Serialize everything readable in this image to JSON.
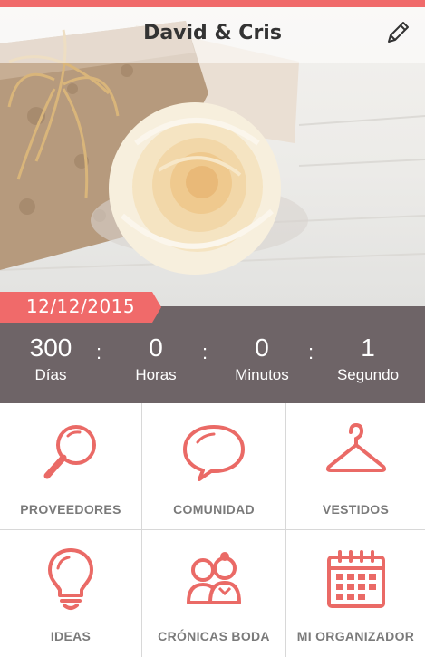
{
  "header": {
    "title": "David & Cris",
    "edit_icon": "pencil-icon"
  },
  "hero": {
    "image": "gift-box-and-white-rose-photo"
  },
  "wedding_date": "12/12/2015",
  "countdown": [
    {
      "value": "300",
      "label": "Días"
    },
    {
      "value": "0",
      "label": "Horas"
    },
    {
      "value": "0",
      "label": "Minutos"
    },
    {
      "value": "1",
      "label": "Segundo"
    }
  ],
  "countdown_separator": ":",
  "menu": [
    {
      "label": "PROVEEDORES",
      "icon": "magnifier-icon"
    },
    {
      "label": "COMUNIDAD",
      "icon": "speech-bubble-icon"
    },
    {
      "label": "VESTIDOS",
      "icon": "hanger-icon"
    },
    {
      "label": "IDEAS",
      "icon": "lightbulb-icon"
    },
    {
      "label": "CRÓNICAS BODA",
      "icon": "couple-icon"
    },
    {
      "label": "MI ORGANIZADOR",
      "icon": "calendar-icon"
    }
  ],
  "colors": {
    "accent": "#f06a6a",
    "countdown_bg": "#6e6467",
    "label_gray": "#7a7a7a"
  }
}
